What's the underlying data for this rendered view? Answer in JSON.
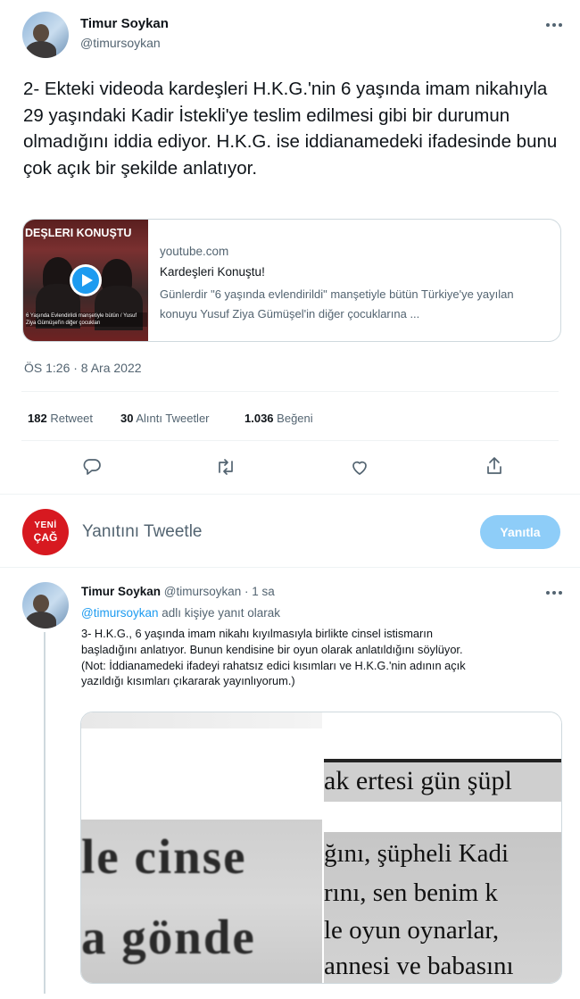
{
  "tweet": {
    "author_name": "Timur Soykan",
    "author_handle": "@timursoykan",
    "text": "2- Ekteki videoda kardeşleri H.K.G.'nin 6 yaşında imam nikahıyla 29 yaşındaki Kadir İstekli'ye teslim edilmesi gibi bir durumun olmadığını iddia ediyor. H.K.G. ise iddianamedeki ifadesinde bunu çok açık bir şekilde anlatıyor.",
    "link_card": {
      "thumb_caption": "DEŞLERI KONUŞTU",
      "thumb_small_text": "6 Yaşında Evlendirildi manşetiyle bütün / Yusuf Ziya Gümüşel'in diğer çocukları",
      "domain": "youtube.com",
      "title": "Kardeşleri Konuştu!",
      "description": "Günlerdir \"6 yaşında evlendirildi\" manşetiyle bütün Türkiye'ye yayılan konuyu Yusuf Ziya Gümüşel'in diğer çocuklarına ..."
    },
    "timestamp": "ÖS 1:26 · 8 Ara 2022",
    "stats": [
      {
        "count": "182",
        "label": "Retweet"
      },
      {
        "count": "30",
        "label": "Alıntı Tweetler"
      },
      {
        "count": "1.036",
        "label": "Beğeni"
      }
    ],
    "more_icon": "ellipsis-icon"
  },
  "actions": [
    "reply-icon",
    "retweet-icon",
    "like-icon",
    "share-icon"
  ],
  "reply_box": {
    "avatar_text_top": "YENİ",
    "avatar_text_bottom": "ÇAĞ",
    "placeholder": "Yanıtını Tweetle",
    "button_label": "Yanıtla"
  },
  "reply_tweet": {
    "author_name": "Timur Soykan",
    "author_handle": "@timursoykan",
    "time": "· 1 sa",
    "reply_to_handle": "@timursoykan",
    "reply_to_text": "adlı kişiye yanıt olarak",
    "text_lines": [
      "3- H.K.G., 6 yaşında imam nikahı kıyılmasıyla birlikte cinsel istismarın",
      "başladığını anlatıyor. Bunun kendisine bir oyun olarak anlatıldığını söylüyor.",
      "(Not: İddianamedeki ifadeyi rahatsız edici kısımları ve H.K.G.'nin adının açık",
      "yazıldığı kısımları çıkararak yayınlıyorum.)"
    ],
    "scan_left": [
      "le cinse",
      "a gönde"
    ],
    "scan_right": [
      "ak ertesi gün şüpl",
      "ğını, şüpheli Kadi",
      "rını, sen benim k",
      "le oyun oynarlar,",
      "annesi ve babasını"
    ]
  },
  "colors": {
    "accent": "#1d9bf0",
    "accent_disabled": "#8ecdf8",
    "muted": "#536471",
    "border": "#cfd9de",
    "yeni_cag_red": "#d71920"
  }
}
